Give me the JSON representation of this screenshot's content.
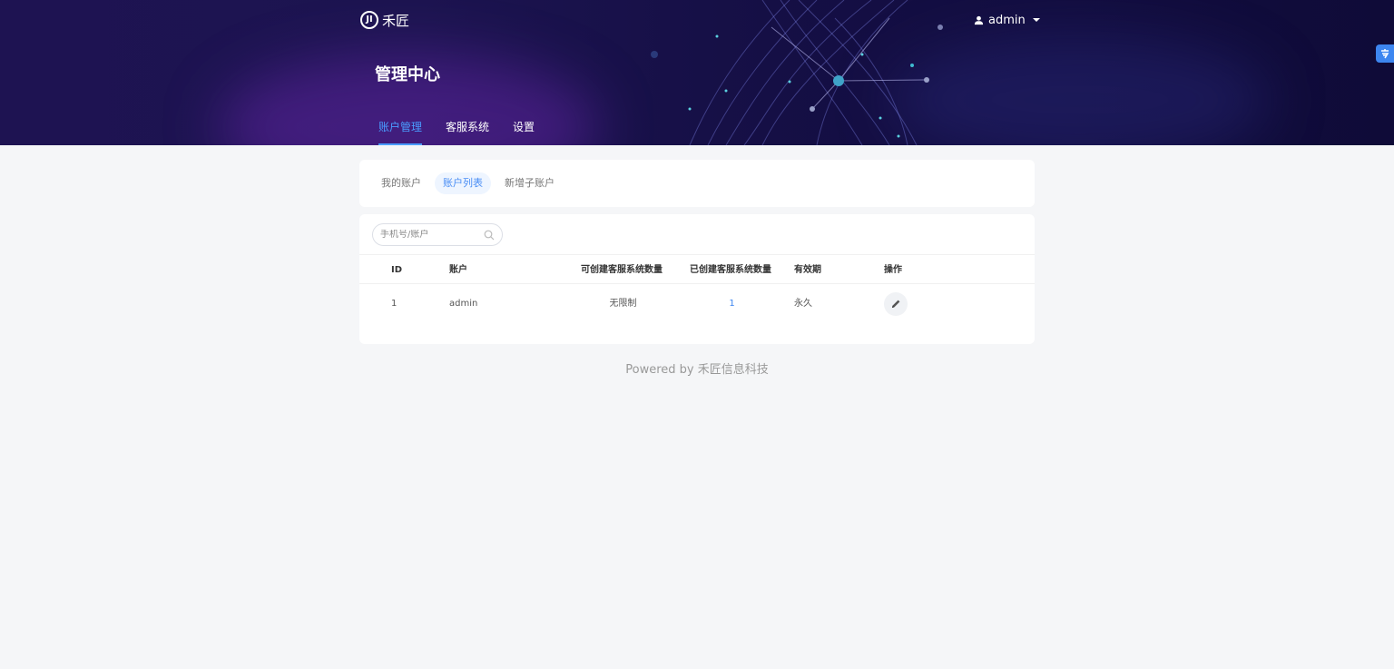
{
  "header": {
    "logo_text": "禾匠",
    "logo_mark": "JI",
    "user_name": "admin",
    "page_title": "管理中心"
  },
  "main_nav": {
    "items": [
      {
        "label": "账户管理",
        "active": true
      },
      {
        "label": "客服系统",
        "active": false
      },
      {
        "label": "设置",
        "active": false
      }
    ]
  },
  "sub_tabs": {
    "items": [
      {
        "label": "我的账户",
        "active": false
      },
      {
        "label": "账户列表",
        "active": true
      },
      {
        "label": "新增子账户",
        "active": false
      }
    ]
  },
  "search": {
    "placeholder": "手机号/账户",
    "value": ""
  },
  "table": {
    "columns": {
      "id": "ID",
      "account": "账户",
      "can_create": "可创建客服系统数量",
      "created": "已创建客服系统数量",
      "valid_until": "有效期",
      "operation": "操作"
    },
    "rows": [
      {
        "id": "1",
        "account": "admin",
        "can_create": "无限制",
        "created": "1",
        "valid_until": "永久"
      }
    ]
  },
  "footer": {
    "text": "Powered by 禾匠信息科技"
  },
  "colors": {
    "accent": "#4a9cff",
    "link": "#3d86f0",
    "banner": "#1c1450"
  }
}
